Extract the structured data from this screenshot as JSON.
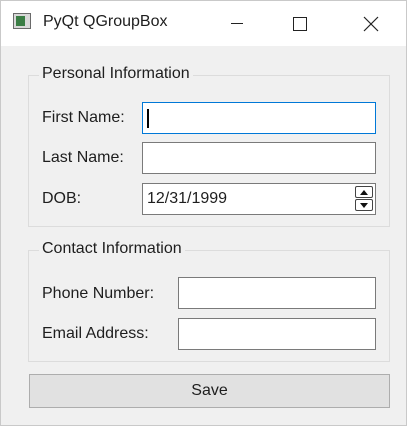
{
  "window": {
    "title": "PyQt QGroupBox",
    "icon": "pyqt-app-icon",
    "controls": [
      "minimize-icon",
      "maximize-icon",
      "close-icon"
    ]
  },
  "personal_group": {
    "title": "Personal Information",
    "first_name_label": "First Name:",
    "first_name_value": "",
    "last_name_label": "Last Name:",
    "last_name_value": "",
    "dob_label": "DOB:",
    "dob_value": "12/31/1999"
  },
  "contact_group": {
    "title": "Contact Information",
    "phone_label": "Phone Number:",
    "phone_value": "",
    "email_label": "Email Address:",
    "email_value": ""
  },
  "save_label": "Save",
  "colors": {
    "focus_border": "#0078d7",
    "window_bg": "#f0f0f0",
    "titlebar_bg": "#ffffff"
  }
}
